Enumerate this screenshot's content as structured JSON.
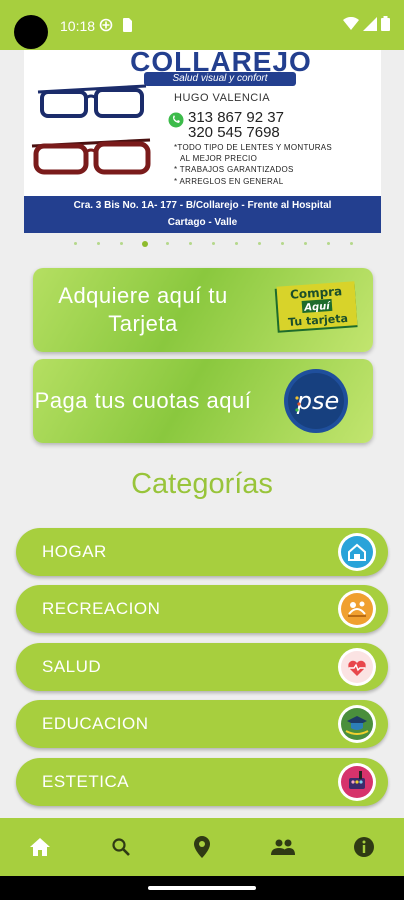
{
  "status_bar": {
    "time": "10:18"
  },
  "banner": {
    "brand": "COLLAREJO",
    "tagline": "Salud visual y confort",
    "owner": "HUGO VALENCIA",
    "phones": [
      "313 867 92 37",
      "320 545 7698"
    ],
    "notes": [
      "*TODO TIPO DE LENTES Y MONTURAS",
      "AL MEJOR PRECIO",
      "* TRABAJOS GARANTIZADOS",
      "* ARREGLOS EN GENERAL"
    ],
    "address": "Cra. 3 Bis No. 1A- 177 - B/Collarejo - Frente al Hospital",
    "city": "Cartago - Valle"
  },
  "carousel": {
    "count": 13,
    "active_index": 3
  },
  "promos": [
    {
      "label": "Adquiere aquí tu Tarjeta",
      "badge_lines": [
        "Compra",
        "Aquí",
        "Tu tarjeta"
      ]
    },
    {
      "label": "Paga tus cuotas aquí",
      "badge": "pse"
    }
  ],
  "categories_title": "Categorías",
  "categories": [
    {
      "label": "HOGAR",
      "icon": "home-icon",
      "color": "#29a3d9"
    },
    {
      "label": "RECREACION",
      "icon": "recreation-icon",
      "color": "#f0a030"
    },
    {
      "label": "SALUD",
      "icon": "heart-icon",
      "color": "#e8474c"
    },
    {
      "label": "EDUCACION",
      "icon": "education-icon",
      "color": "#4a8f3c"
    },
    {
      "label": "ESTETICA",
      "icon": "beauty-icon",
      "color": "#d6336c"
    }
  ],
  "bottom_nav": [
    {
      "icon": "home-icon"
    },
    {
      "icon": "search-icon"
    },
    {
      "icon": "location-icon"
    },
    {
      "icon": "people-icon"
    },
    {
      "icon": "info-icon"
    }
  ],
  "colors": {
    "primary": "#a7cf3e",
    "title": "#98c43a",
    "banner_blue": "#233f8f"
  }
}
